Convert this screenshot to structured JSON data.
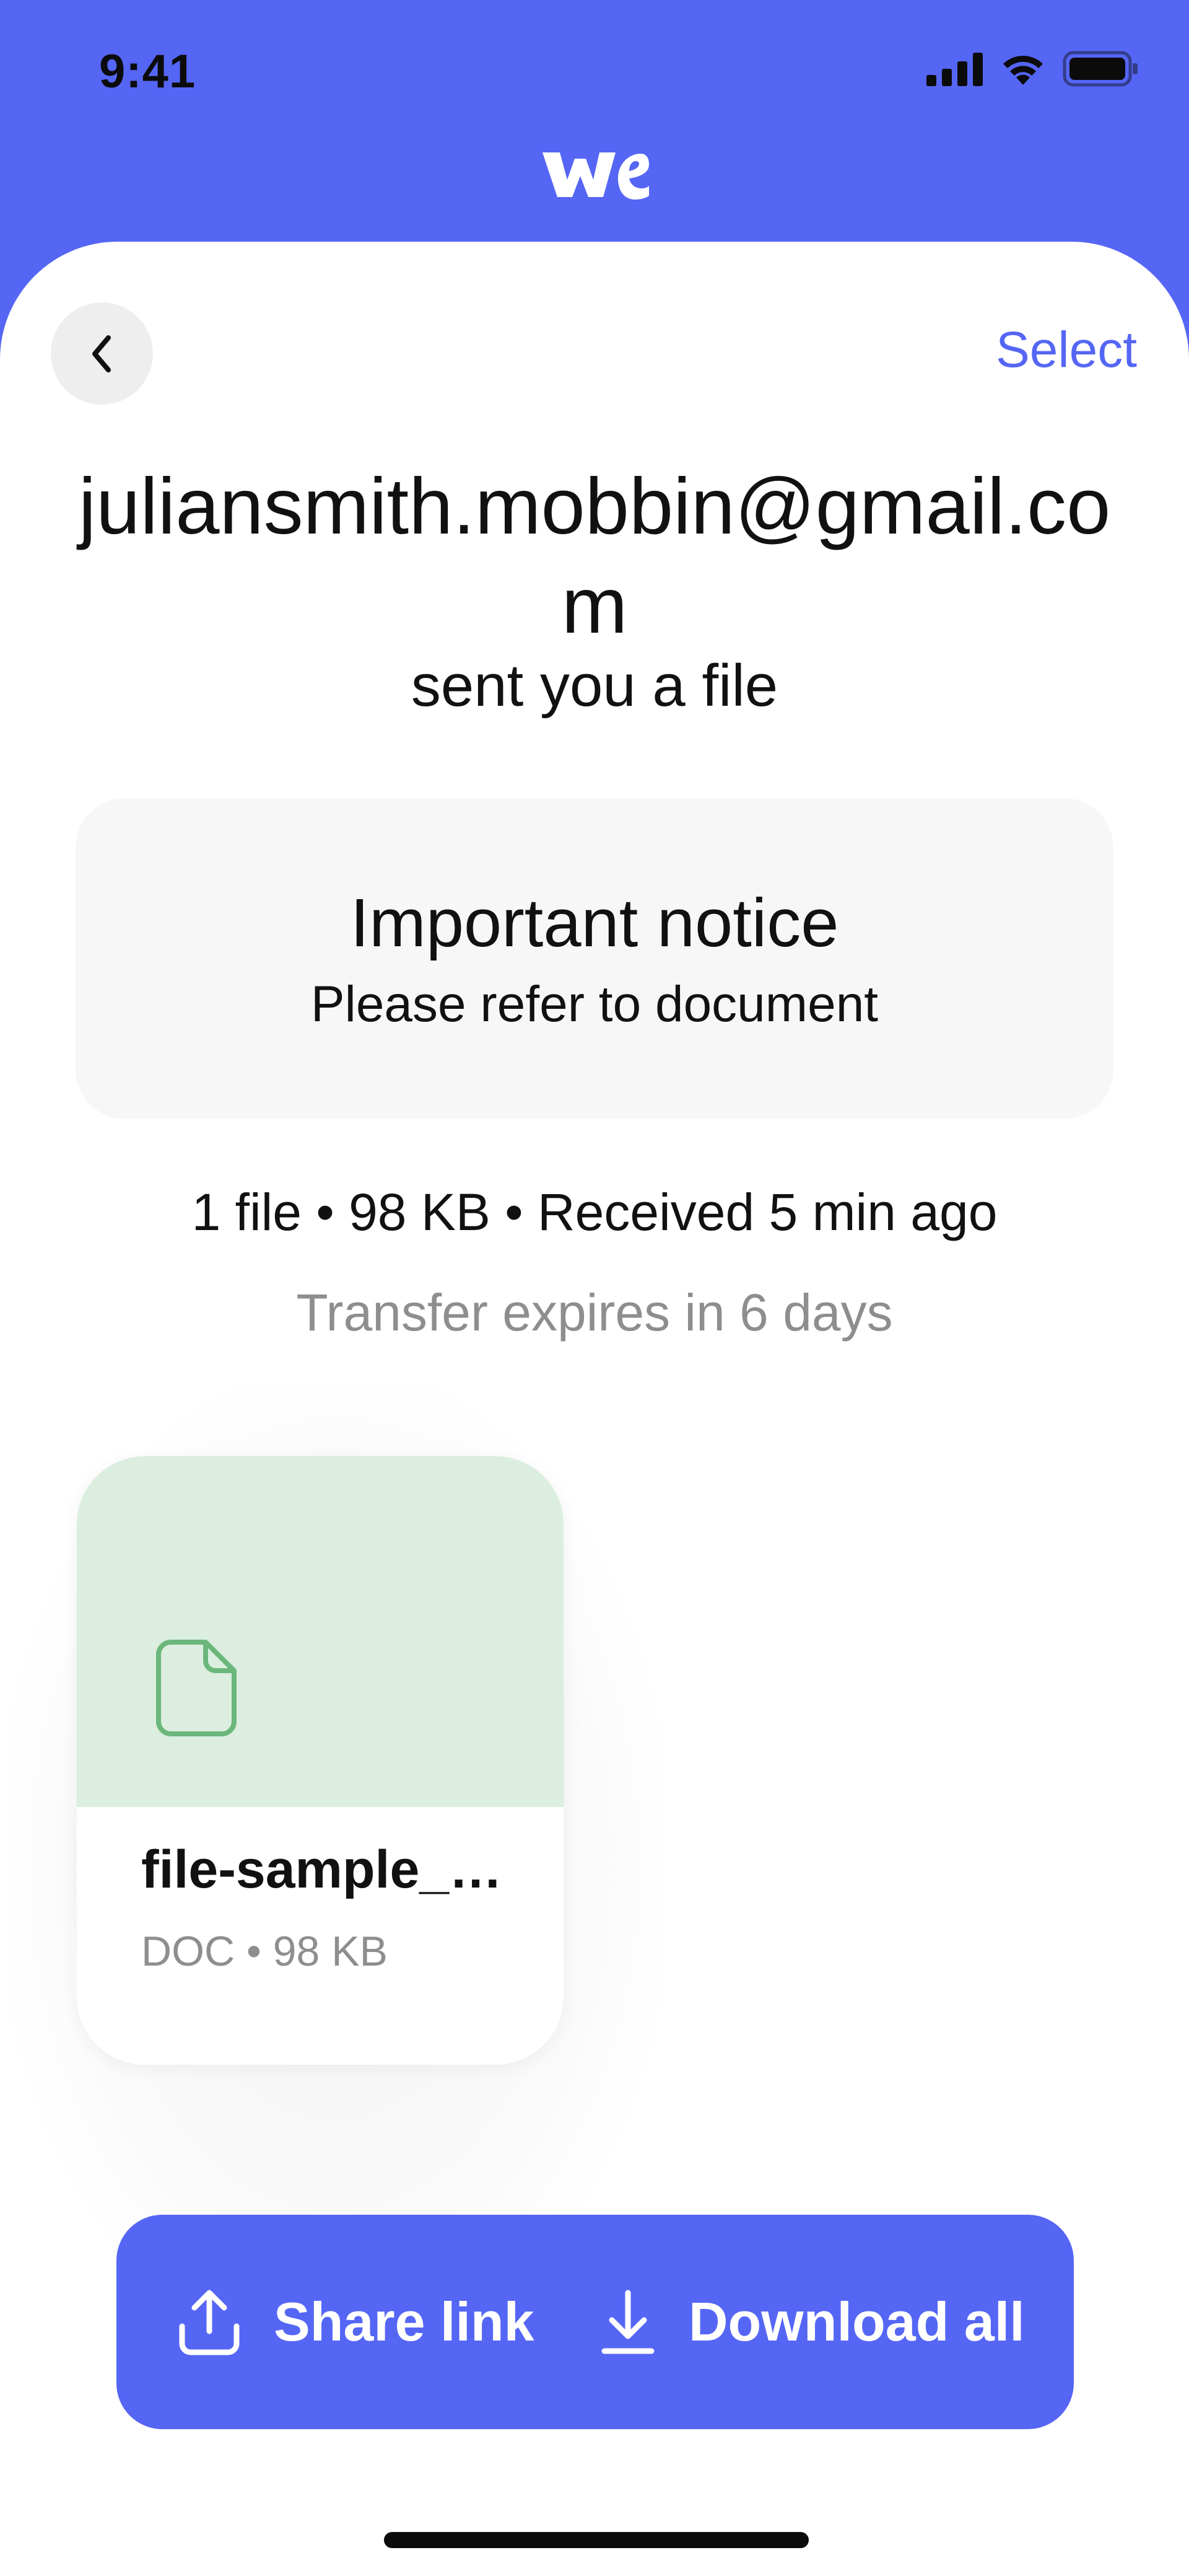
{
  "status_bar": {
    "time": "9:41",
    "icons": [
      "signal-icon",
      "wifi-icon",
      "battery-icon"
    ]
  },
  "header": {
    "logo": "wetransfer-logo"
  },
  "nav": {
    "back_icon": "chevron-left-icon",
    "select_label": "Select"
  },
  "transfer": {
    "sender": "juliansmith.mobbin@gmail.com",
    "sent_text": "sent you a file",
    "notice_title": "Important notice",
    "notice_message": "Please refer to document",
    "summary": "1 file • 98 KB • Received 5 min ago",
    "expiry": "Transfer expires in 6 days"
  },
  "files": [
    {
      "name": "file-sample_…",
      "meta": "DOC • 98 KB",
      "icon": "document-icon"
    }
  ],
  "actions": {
    "share_label": "Share link",
    "download_label": "Download all"
  },
  "colors": {
    "brand": "#5566F5",
    "thumb_bg": "#DBEEDF",
    "file_icon": "#6BB77B",
    "muted_text": "#8E8E8E"
  }
}
